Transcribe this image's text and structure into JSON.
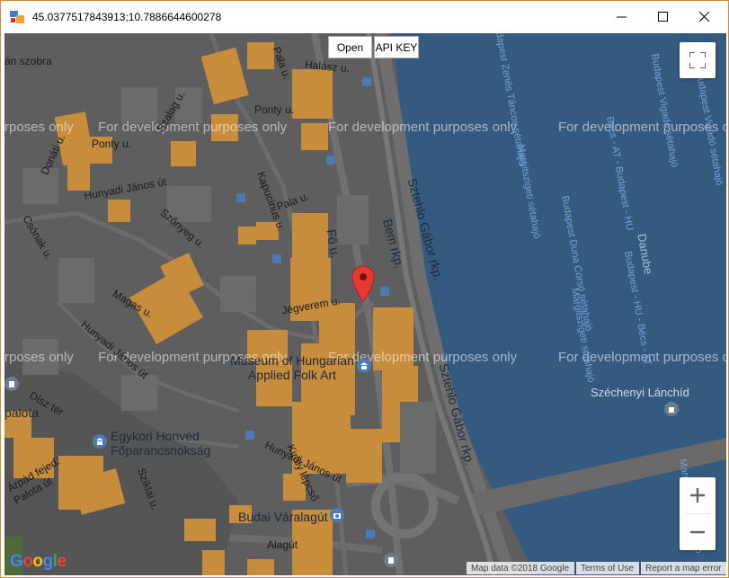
{
  "window": {
    "title": "45.0377517843913;10.7886644600278"
  },
  "toolbar": {
    "open_label": "Open",
    "api_key_label": "API KEY"
  },
  "map": {
    "watermark": "For development purposes only",
    "watermark_partial_left": "rposes only",
    "labels": {
      "szobra": "án szobra",
      "halasz": "Halász u.",
      "ponty1": "Ponty u.",
      "ponty2": "Ponty u.",
      "szalag": "Szalag u.",
      "donati": "Donáti u.",
      "kapucinus": "Kapucinus u.",
      "pala": "Pala u.",
      "pala2": "Pala u.",
      "csonak": "Csónak u.",
      "szonyeg": "Szőnyeg u.",
      "hunyadi1": "Hunyadi János út",
      "hunyadi2": "Hunyadi János út",
      "hunyadi3": "Hunyadi János út",
      "fo": "Fő u.",
      "bem": "Bem rkp.",
      "sztehlo1": "Sztehlo Gábor rkp.",
      "sztehlo2": "Sztehlo Gábor rkp.",
      "magas": "Magas u.",
      "jegverem": "Jégverem u.",
      "disz": "Dísz tér",
      "palota": "palota",
      "arpad": "Árpád fejed.",
      "palota_u": "Palota út",
      "szikla": "Sziklai u.",
      "kiraly": "Király lépcső",
      "aqlagut": "Alagút",
      "museum": "Museum of Hungarian Applied Folk Art",
      "honved": "Egykori Honvéd Főparancsnokság",
      "varalagut": "Budai Váralagút",
      "danube": "Danube",
      "szechenyi": "Széchenyi Lánchíd"
    },
    "water_labels": [
      "Budapest Vigadó sétahajó",
      "Margitszigeti sétahajó",
      "Budapest Zenés Táncos sétahajó",
      "Budapest Duna Corsó sétahajó",
      "Budapest - HU - Bécs - AT",
      "Bécs - AT - Budapest - HU"
    ],
    "footer": {
      "map_data": "Map data ©2018 Google",
      "terms": "Terms of Use",
      "report": "Report a map error"
    },
    "google_logo": "Google"
  },
  "colors": {
    "water": "#355a80",
    "land": "#5f5f5f",
    "building": "#c78c3c",
    "road": "#7a7a7a",
    "marker": "#e53935"
  },
  "icons": {
    "fullscreen": "fullscreen-icon",
    "zoom_in": "plus-icon",
    "zoom_out": "minus-icon",
    "marker": "map-marker-icon"
  }
}
